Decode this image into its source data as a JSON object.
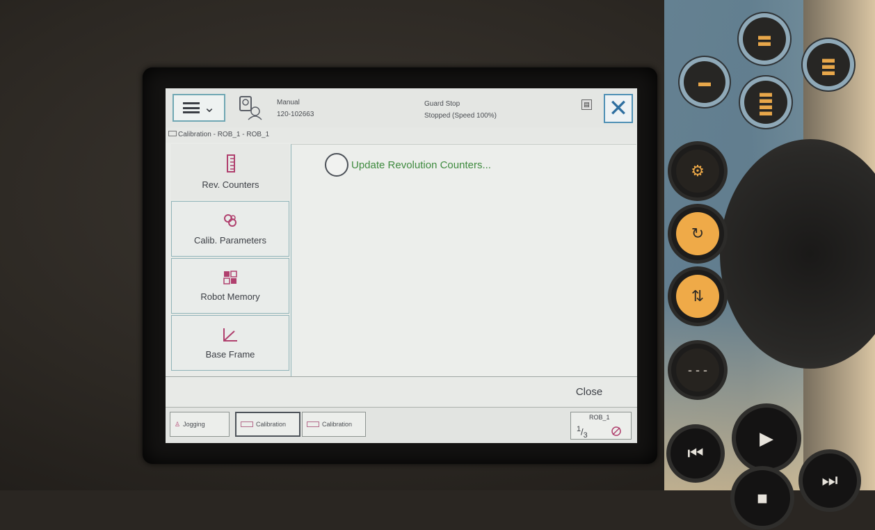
{
  "header": {
    "mode": "Manual",
    "controller_id": "120-102663",
    "guard_status": "Guard Stop",
    "run_status": "Stopped (Speed 100%)",
    "menu_icon": "hamburger-menu-icon",
    "close_icon": "close-x-icon"
  },
  "breadcrumb": "Calibration - ROB_1 - ROB_1",
  "sidebar": {
    "items": [
      {
        "label": "Rev. Counters",
        "icon": "rev-counters-icon",
        "active": true
      },
      {
        "label": "Calib. Parameters",
        "icon": "calib-parameters-icon",
        "active": false
      },
      {
        "label": "Robot Memory",
        "icon": "robot-memory-icon",
        "active": false
      },
      {
        "label": "Base Frame",
        "icon": "base-frame-icon",
        "active": false
      }
    ]
  },
  "main": {
    "option_label": "Update Revolution Counters..."
  },
  "actions": {
    "close_label": "Close"
  },
  "taskbar": {
    "tasks": [
      {
        "label": "Jogging"
      },
      {
        "label": "Calibration"
      },
      {
        "label": "Calibration"
      }
    ],
    "robot": {
      "name": "ROB_1",
      "fraction_num": "1",
      "fraction_den": "3"
    }
  },
  "colors": {
    "accent_border": "#6fa7b3",
    "option_text": "#3e8a3e",
    "icon_magenta": "#b0406e",
    "hardware_orange": "#efaa48",
    "hardware_blue": "#8fa9b8"
  }
}
